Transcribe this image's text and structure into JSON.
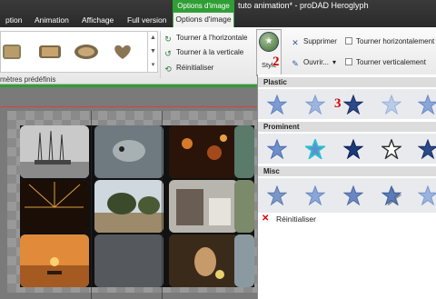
{
  "window": {
    "title": "tuto animation* - proDAD Heroglyph"
  },
  "tabs": [
    {
      "label": "ption"
    },
    {
      "label": "Animation"
    },
    {
      "label": "Affichage"
    },
    {
      "label": "Full version"
    }
  ],
  "context_tab": {
    "header": "Options d'image",
    "label": "Options d'image"
  },
  "ribbon": {
    "group_label": "mètres prédéfinis",
    "rotate_horizontal": "Tourner à l'horizontale",
    "rotate_vertical": "Tourner à la verticale",
    "reset": "Réinitialiser",
    "style": "Style",
    "delete": "Supprimer",
    "open": "Ouvrir...",
    "flip_horizontal": "Tourner horizontalement",
    "flip_vertical": "Tourner verticalement"
  },
  "annotations": {
    "n2": "2",
    "n3": "3"
  },
  "dropdown": {
    "sections": [
      {
        "title": "Plastic"
      },
      {
        "title": "Prominent"
      },
      {
        "title": "Misc"
      }
    ],
    "reset_label": "Réinitialiser"
  },
  "colors": {
    "context_green": "#2f9e35",
    "annotation_red": "#d00000",
    "star_blue": "#5c7fbf"
  }
}
